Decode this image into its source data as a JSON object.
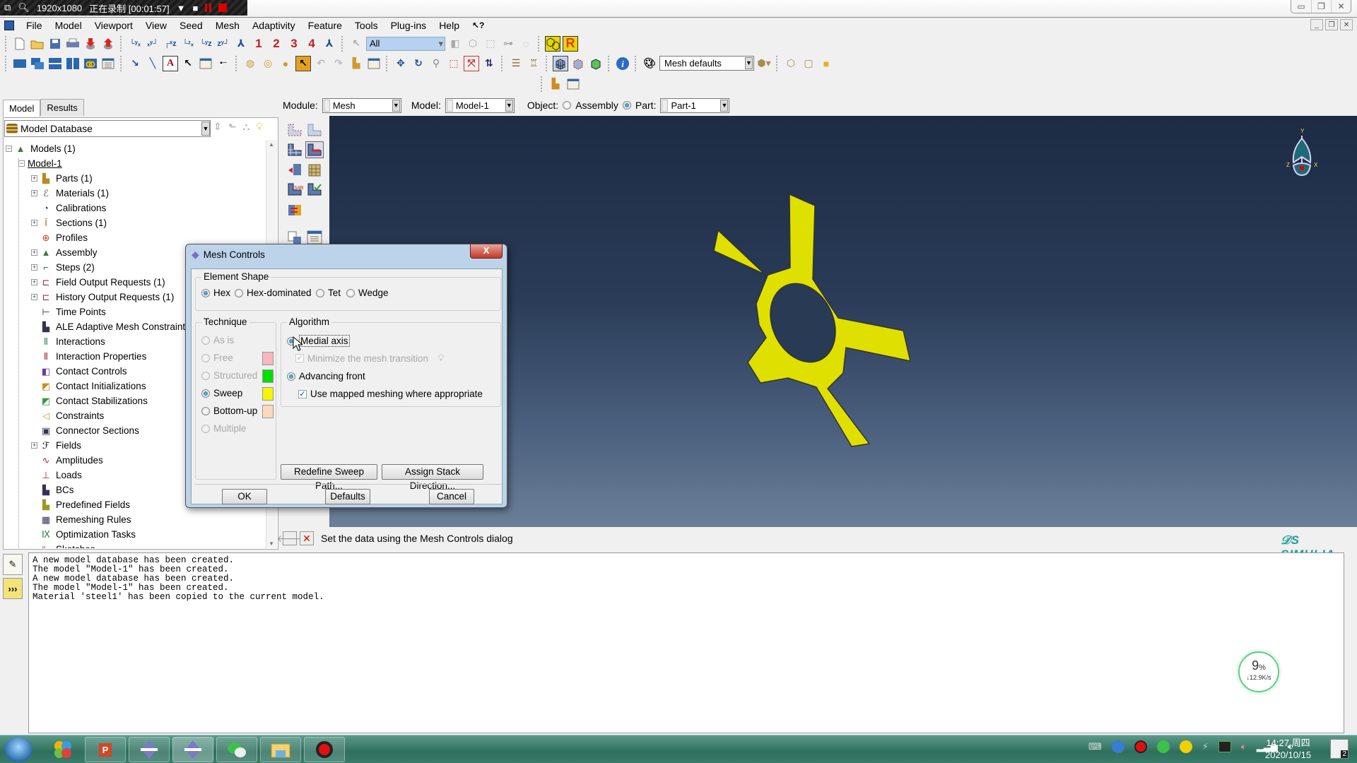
{
  "recorder": {
    "resolution": "1920x1080",
    "status": "正在录制 [00:01:57]"
  },
  "menu": {
    "items": [
      "File",
      "Model",
      "Viewport",
      "View",
      "Seed",
      "Mesh",
      "Adaptivity",
      "Feature",
      "Tools",
      "Plug-ins",
      "Help",
      "↖?"
    ]
  },
  "toolbar": {
    "selection_filter": "All",
    "render_style_label": "Mesh defaults",
    "view_numbers": [
      "1",
      "2",
      "3",
      "4"
    ]
  },
  "context": {
    "module_label": "Module:",
    "module_value": "Mesh",
    "model_label": "Model:",
    "model_value": "Model-1",
    "object_label": "Object:",
    "assembly_label": "Assembly",
    "part_label": "Part:",
    "part_value": "Part-1",
    "object_selected": "Part"
  },
  "tree_panel": {
    "tabs": [
      {
        "label": "Model",
        "active": true
      },
      {
        "label": "Results",
        "active": false
      }
    ],
    "database_label": "Model Database",
    "nodes": [
      {
        "label": "Models (1)",
        "level": 0,
        "expander": "minus"
      },
      {
        "label": "Model-1",
        "level": 1,
        "expander": "minus",
        "underline": true
      },
      {
        "label": "Parts (1)",
        "level": 2,
        "expander": "plus",
        "icon": "parts-icon"
      },
      {
        "label": "Materials (1)",
        "level": 2,
        "expander": "plus",
        "icon": "materials-icon"
      },
      {
        "label": "Calibrations",
        "level": 2,
        "expander": "none",
        "icon": "calibrations-icon"
      },
      {
        "label": "Sections (1)",
        "level": 2,
        "expander": "plus",
        "icon": "sections-icon"
      },
      {
        "label": "Profiles",
        "level": 2,
        "expander": "none",
        "icon": "profiles-icon"
      },
      {
        "label": "Assembly",
        "level": 2,
        "expander": "plus",
        "icon": "assembly-icon"
      },
      {
        "label": "Steps (2)",
        "level": 2,
        "expander": "plus",
        "icon": "steps-icon"
      },
      {
        "label": "Field Output Requests (1)",
        "level": 2,
        "expander": "plus",
        "icon": "field-output-icon"
      },
      {
        "label": "History Output Requests (1)",
        "level": 2,
        "expander": "plus",
        "icon": "history-output-icon"
      },
      {
        "label": "Time Points",
        "level": 2,
        "expander": "none",
        "icon": "time-points-icon"
      },
      {
        "label": "ALE Adaptive Mesh Constraints",
        "level": 2,
        "expander": "none",
        "icon": "ale-icon"
      },
      {
        "label": "Interactions",
        "level": 2,
        "expander": "none",
        "icon": "interactions-icon"
      },
      {
        "label": "Interaction Properties",
        "level": 2,
        "expander": "none",
        "icon": "interaction-properties-icon"
      },
      {
        "label": "Contact Controls",
        "level": 2,
        "expander": "none",
        "icon": "contact-controls-icon"
      },
      {
        "label": "Contact Initializations",
        "level": 2,
        "expander": "none",
        "icon": "contact-init-icon"
      },
      {
        "label": "Contact Stabilizations",
        "level": 2,
        "expander": "none",
        "icon": "contact-stab-icon"
      },
      {
        "label": "Constraints",
        "level": 2,
        "expander": "none",
        "icon": "constraints-icon"
      },
      {
        "label": "Connector Sections",
        "level": 2,
        "expander": "none",
        "icon": "connector-sections-icon"
      },
      {
        "label": "Fields",
        "level": 2,
        "expander": "plus",
        "icon": "fields-icon"
      },
      {
        "label": "Amplitudes",
        "level": 2,
        "expander": "none",
        "icon": "amplitudes-icon"
      },
      {
        "label": "Loads",
        "level": 2,
        "expander": "none",
        "icon": "loads-icon"
      },
      {
        "label": "BCs",
        "level": 2,
        "expander": "none",
        "icon": "bcs-icon"
      },
      {
        "label": "Predefined Fields",
        "level": 2,
        "expander": "none",
        "icon": "predefined-fields-icon"
      },
      {
        "label": "Remeshing Rules",
        "level": 2,
        "expander": "none",
        "icon": "remeshing-rules-icon"
      },
      {
        "label": "Optimization Tasks",
        "level": 2,
        "expander": "none",
        "icon": "optimization-tasks-icon"
      },
      {
        "label": "Sketches",
        "level": 2,
        "expander": "none",
        "icon": "sketches-icon"
      }
    ]
  },
  "dialog": {
    "title": "Mesh Controls",
    "close_label": "X",
    "element_shape": {
      "title": "Element Shape",
      "options": [
        {
          "label": "Hex",
          "selected": true
        },
        {
          "label": "Hex-dominated",
          "selected": false
        },
        {
          "label": "Tet",
          "selected": false
        },
        {
          "label": "Wedge",
          "selected": false
        }
      ]
    },
    "technique": {
      "title": "Technique",
      "options": [
        {
          "label": "As is",
          "selected": false,
          "enabled": false,
          "color": null
        },
        {
          "label": "Free",
          "selected": false,
          "enabled": false,
          "color": "#f7b6c0"
        },
        {
          "label": "Structured",
          "selected": false,
          "enabled": false,
          "color": "#00e000"
        },
        {
          "label": "Sweep",
          "selected": true,
          "enabled": true,
          "color": "#f5f500"
        },
        {
          "label": "Bottom-up",
          "selected": false,
          "enabled": true,
          "color": "#fcd9bb"
        },
        {
          "label": "Multiple",
          "selected": false,
          "enabled": false,
          "color": null
        }
      ]
    },
    "algorithm": {
      "title": "Algorithm",
      "medial_axis": {
        "label": "Medial axis",
        "selected": true
      },
      "minimize_transition": {
        "label": "Minimize the mesh transition",
        "checked": true,
        "enabled": false
      },
      "advancing_front": {
        "label": "Advancing front",
        "selected": true
      },
      "use_mapped": {
        "label": "Use mapped meshing where appropriate",
        "checked": true
      }
    },
    "buttons": {
      "redefine_sweep": "Redefine Sweep Path...",
      "assign_stack": "Assign Stack Direction...",
      "ok": "OK",
      "defaults": "Defaults",
      "cancel": "Cancel"
    }
  },
  "viewport": {
    "triad_labels": {
      "x": "X",
      "y": "Y",
      "z": "Z"
    },
    "part_color": "#e0e000",
    "brand": "SIMULIA"
  },
  "prompt": {
    "text": "Set the data using the Mesh Controls dialog"
  },
  "messages": [
    "A new model database has been created.",
    "The model \"Model-1\" has been created.",
    "A new model database has been created.",
    "The model \"Model-1\" has been created.",
    "Material 'steel1' has been copied to the current model."
  ],
  "network_monitor": {
    "percent": "9",
    "percent_sign": "%",
    "speed": "↓12.9K/s"
  },
  "taskbar": {
    "apps": [
      "start-button",
      "app-launcher",
      "powerpoint",
      "abaqus-1",
      "abaqus-2",
      "wechat",
      "file-explorer",
      "screen-recorder"
    ],
    "clock_time": "14:27 周四",
    "clock_date": "2020/10/15",
    "notification_count": "2"
  }
}
